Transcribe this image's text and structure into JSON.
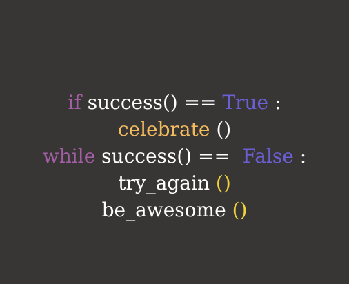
{
  "colors": {
    "background": "#383634",
    "keyword": "#a45ea6",
    "default": "#ffffff",
    "boolean": "#6a5fd4",
    "function": "#f3bb5f",
    "paren_accent": "#f1d23a"
  },
  "code": {
    "line1": {
      "kw_if": "if",
      "text": " success() == ",
      "bool_true": "True",
      "colon": " :"
    },
    "line2": {
      "fn_celebrate": "celebrate",
      "parens": " ()"
    },
    "line3": {
      "kw_while": "while",
      "text": " success() ==  ",
      "bool_false": "False",
      "colon": " :"
    },
    "line4": {
      "fn_try_again": "try_again ",
      "parens": "()"
    },
    "line5": {
      "fn_be_awesome": "be_awesome ",
      "parens": "()"
    }
  }
}
